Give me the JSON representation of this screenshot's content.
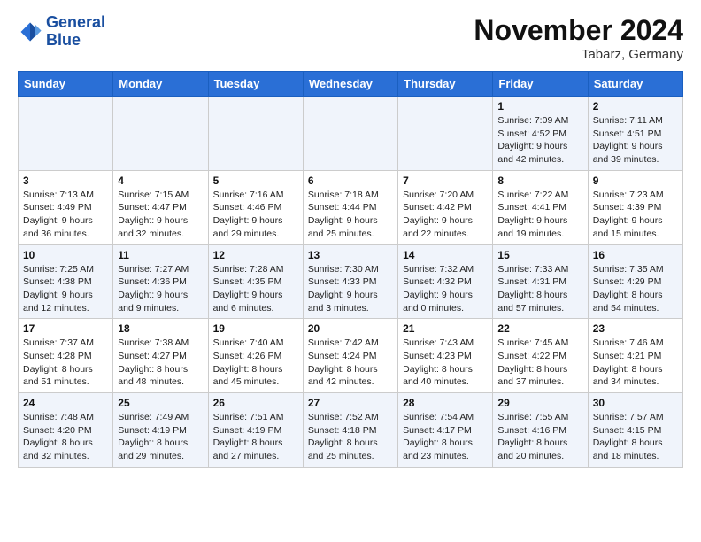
{
  "header": {
    "logo_general": "General",
    "logo_blue": "Blue",
    "month_year": "November 2024",
    "location": "Tabarz, Germany"
  },
  "days_of_week": [
    "Sunday",
    "Monday",
    "Tuesday",
    "Wednesday",
    "Thursday",
    "Friday",
    "Saturday"
  ],
  "weeks": [
    [
      {
        "day": "",
        "info": ""
      },
      {
        "day": "",
        "info": ""
      },
      {
        "day": "",
        "info": ""
      },
      {
        "day": "",
        "info": ""
      },
      {
        "day": "",
        "info": ""
      },
      {
        "day": "1",
        "info": "Sunrise: 7:09 AM\nSunset: 4:52 PM\nDaylight: 9 hours\nand 42 minutes."
      },
      {
        "day": "2",
        "info": "Sunrise: 7:11 AM\nSunset: 4:51 PM\nDaylight: 9 hours\nand 39 minutes."
      }
    ],
    [
      {
        "day": "3",
        "info": "Sunrise: 7:13 AM\nSunset: 4:49 PM\nDaylight: 9 hours\nand 36 minutes."
      },
      {
        "day": "4",
        "info": "Sunrise: 7:15 AM\nSunset: 4:47 PM\nDaylight: 9 hours\nand 32 minutes."
      },
      {
        "day": "5",
        "info": "Sunrise: 7:16 AM\nSunset: 4:46 PM\nDaylight: 9 hours\nand 29 minutes."
      },
      {
        "day": "6",
        "info": "Sunrise: 7:18 AM\nSunset: 4:44 PM\nDaylight: 9 hours\nand 25 minutes."
      },
      {
        "day": "7",
        "info": "Sunrise: 7:20 AM\nSunset: 4:42 PM\nDaylight: 9 hours\nand 22 minutes."
      },
      {
        "day": "8",
        "info": "Sunrise: 7:22 AM\nSunset: 4:41 PM\nDaylight: 9 hours\nand 19 minutes."
      },
      {
        "day": "9",
        "info": "Sunrise: 7:23 AM\nSunset: 4:39 PM\nDaylight: 9 hours\nand 15 minutes."
      }
    ],
    [
      {
        "day": "10",
        "info": "Sunrise: 7:25 AM\nSunset: 4:38 PM\nDaylight: 9 hours\nand 12 minutes."
      },
      {
        "day": "11",
        "info": "Sunrise: 7:27 AM\nSunset: 4:36 PM\nDaylight: 9 hours\nand 9 minutes."
      },
      {
        "day": "12",
        "info": "Sunrise: 7:28 AM\nSunset: 4:35 PM\nDaylight: 9 hours\nand 6 minutes."
      },
      {
        "day": "13",
        "info": "Sunrise: 7:30 AM\nSunset: 4:33 PM\nDaylight: 9 hours\nand 3 minutes."
      },
      {
        "day": "14",
        "info": "Sunrise: 7:32 AM\nSunset: 4:32 PM\nDaylight: 9 hours\nand 0 minutes."
      },
      {
        "day": "15",
        "info": "Sunrise: 7:33 AM\nSunset: 4:31 PM\nDaylight: 8 hours\nand 57 minutes."
      },
      {
        "day": "16",
        "info": "Sunrise: 7:35 AM\nSunset: 4:29 PM\nDaylight: 8 hours\nand 54 minutes."
      }
    ],
    [
      {
        "day": "17",
        "info": "Sunrise: 7:37 AM\nSunset: 4:28 PM\nDaylight: 8 hours\nand 51 minutes."
      },
      {
        "day": "18",
        "info": "Sunrise: 7:38 AM\nSunset: 4:27 PM\nDaylight: 8 hours\nand 48 minutes."
      },
      {
        "day": "19",
        "info": "Sunrise: 7:40 AM\nSunset: 4:26 PM\nDaylight: 8 hours\nand 45 minutes."
      },
      {
        "day": "20",
        "info": "Sunrise: 7:42 AM\nSunset: 4:24 PM\nDaylight: 8 hours\nand 42 minutes."
      },
      {
        "day": "21",
        "info": "Sunrise: 7:43 AM\nSunset: 4:23 PM\nDaylight: 8 hours\nand 40 minutes."
      },
      {
        "day": "22",
        "info": "Sunrise: 7:45 AM\nSunset: 4:22 PM\nDaylight: 8 hours\nand 37 minutes."
      },
      {
        "day": "23",
        "info": "Sunrise: 7:46 AM\nSunset: 4:21 PM\nDaylight: 8 hours\nand 34 minutes."
      }
    ],
    [
      {
        "day": "24",
        "info": "Sunrise: 7:48 AM\nSunset: 4:20 PM\nDaylight: 8 hours\nand 32 minutes."
      },
      {
        "day": "25",
        "info": "Sunrise: 7:49 AM\nSunset: 4:19 PM\nDaylight: 8 hours\nand 29 minutes."
      },
      {
        "day": "26",
        "info": "Sunrise: 7:51 AM\nSunset: 4:19 PM\nDaylight: 8 hours\nand 27 minutes."
      },
      {
        "day": "27",
        "info": "Sunrise: 7:52 AM\nSunset: 4:18 PM\nDaylight: 8 hours\nand 25 minutes."
      },
      {
        "day": "28",
        "info": "Sunrise: 7:54 AM\nSunset: 4:17 PM\nDaylight: 8 hours\nand 23 minutes."
      },
      {
        "day": "29",
        "info": "Sunrise: 7:55 AM\nSunset: 4:16 PM\nDaylight: 8 hours\nand 20 minutes."
      },
      {
        "day": "30",
        "info": "Sunrise: 7:57 AM\nSunset: 4:15 PM\nDaylight: 8 hours\nand 18 minutes."
      }
    ]
  ]
}
